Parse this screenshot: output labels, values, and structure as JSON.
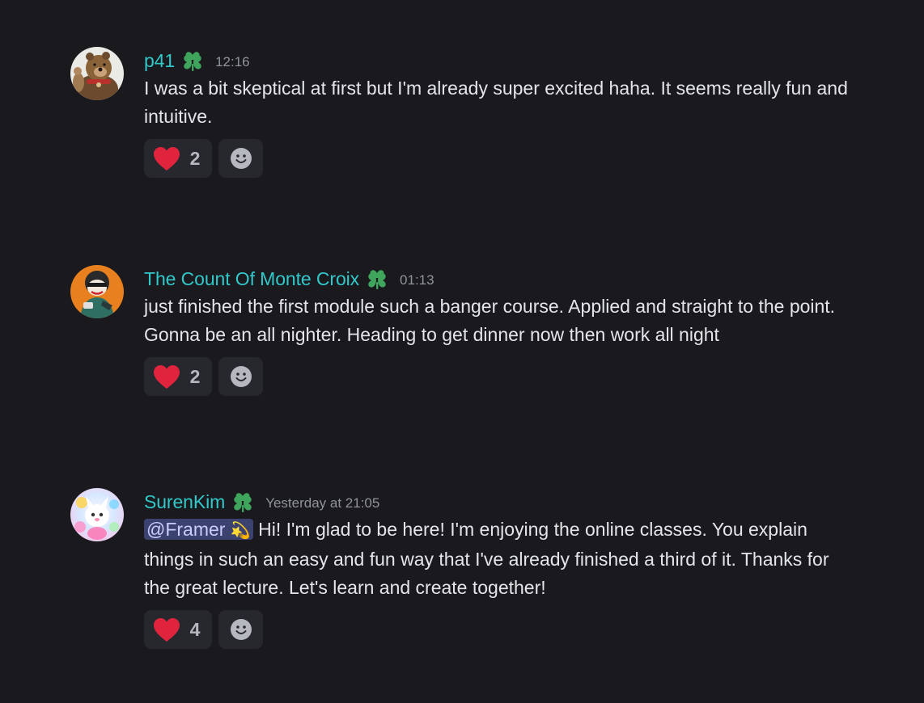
{
  "messages": [
    {
      "username": "p41",
      "role_icon": "clover-role-icon",
      "timestamp": "12:16",
      "text": "I was a bit skeptical at first but I'm already super excited haha. It seems really fun and intuitive.",
      "reaction": {
        "emoji": "heart",
        "count": "2"
      },
      "add_reaction_icon": "smile-face-icon"
    },
    {
      "username": "The Count Of Monte Croix",
      "role_icon": "clover-role-icon",
      "timestamp": "01:13",
      "text": "just finished the first module such a banger course. Applied and straight to the point. Gonna be an all nighter. Heading to get dinner now then work all night",
      "reaction": {
        "emoji": "heart",
        "count": "2"
      },
      "add_reaction_icon": "smile-face-icon"
    },
    {
      "username": "SurenKim",
      "role_icon": "clover-role-icon",
      "timestamp": "Yesterday at 21:05",
      "mention": "@Framer",
      "mention_emoji": "💫",
      "text": " Hi! I'm glad to be here! I'm enjoying the online classes. You explain things in such an easy and fun way that I've already finished a third of it. Thanks for the great lecture. Let's learn and create together!",
      "reaction": {
        "emoji": "heart",
        "count": "4"
      },
      "add_reaction_icon": "smile-face-icon"
    }
  ],
  "colors": {
    "background": "#1a1a1e",
    "username": "#31c8ca",
    "role_icon": "#3fa55c",
    "timestamp": "#8f939b",
    "heart": "#e0243d",
    "reaction_bg": "#27282d",
    "mention_bg": "#3c4270"
  }
}
